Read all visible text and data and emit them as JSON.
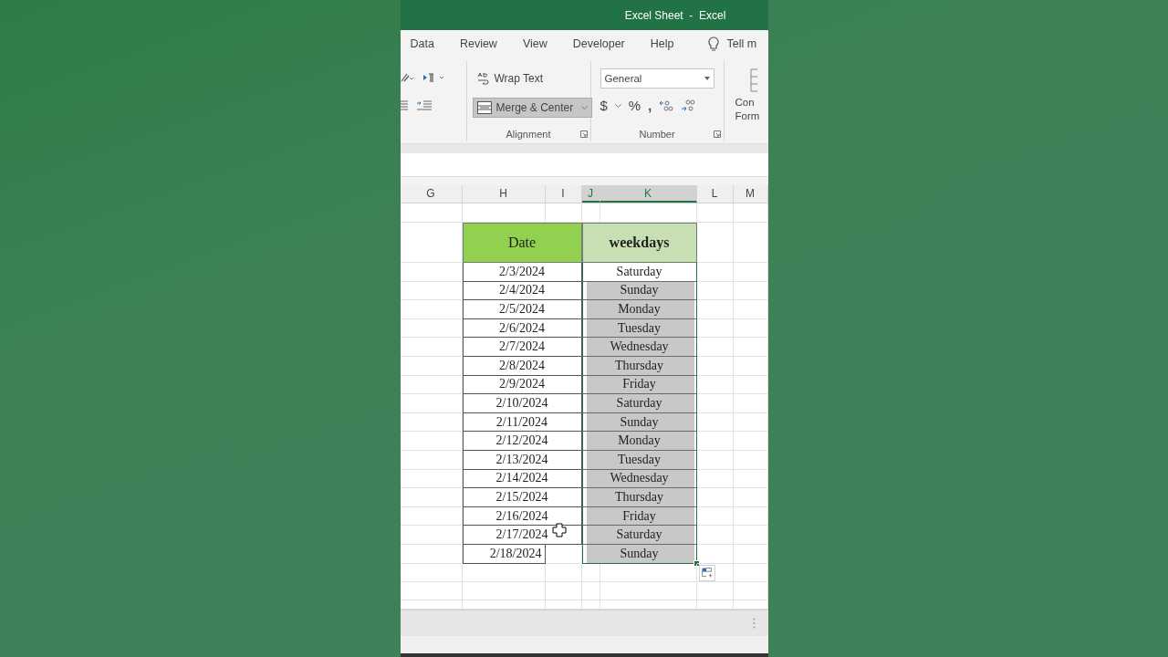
{
  "window": {
    "title": "Excel Sheet  -  Excel"
  },
  "ribbon_tabs": [
    "Data",
    "Review",
    "View",
    "Developer",
    "Help"
  ],
  "tell_me": "Tell m",
  "ribbon": {
    "alignment": {
      "label": "Alignment",
      "wrap_text": "Wrap Text",
      "merge_center": {
        "label": "Merge & Center",
        "pressed": true
      }
    },
    "number": {
      "label": "Number",
      "format": "General",
      "currency": "$",
      "percent": "%",
      "comma": ","
    },
    "cut_group": [
      "Con",
      "Form"
    ]
  },
  "sheet": {
    "columns": [
      {
        "label": "G",
        "selected": false
      },
      {
        "label": "H",
        "selected": false
      },
      {
        "label": "I",
        "selected": false
      },
      {
        "label": "J",
        "selected": true
      },
      {
        "label": "K",
        "selected": true
      },
      {
        "label": "L",
        "selected": false
      },
      {
        "label": "M",
        "selected": false
      }
    ],
    "header": {
      "date": "Date",
      "weekdays": "weekdays"
    },
    "rows": [
      {
        "date": "2/3/2024",
        "weekday": "Saturday",
        "highlighted": false,
        "merged": true
      },
      {
        "date": "2/4/2024",
        "weekday": "Sunday",
        "highlighted": true,
        "merged": true
      },
      {
        "date": "2/5/2024",
        "weekday": "Monday",
        "highlighted": true,
        "merged": true
      },
      {
        "date": "2/6/2024",
        "weekday": "Tuesday",
        "highlighted": true,
        "merged": true
      },
      {
        "date": "2/7/2024",
        "weekday": "Wednesday",
        "highlighted": true,
        "merged": true
      },
      {
        "date": "2/8/2024",
        "weekday": "Thursday",
        "highlighted": true,
        "merged": true
      },
      {
        "date": "2/9/2024",
        "weekday": "Friday",
        "highlighted": true,
        "merged": true
      },
      {
        "date": "2/10/2024",
        "weekday": "Saturday",
        "highlighted": true,
        "merged": true
      },
      {
        "date": "2/11/2024",
        "weekday": "Sunday",
        "highlighted": true,
        "merged": true
      },
      {
        "date": "2/12/2024",
        "weekday": "Monday",
        "highlighted": true,
        "merged": true
      },
      {
        "date": "2/13/2024",
        "weekday": "Tuesday",
        "highlighted": true,
        "merged": true
      },
      {
        "date": "2/14/2024",
        "weekday": "Wednesday",
        "highlighted": true,
        "merged": true
      },
      {
        "date": "2/15/2024",
        "weekday": "Thursday",
        "highlighted": true,
        "merged": true
      },
      {
        "date": "2/16/2024",
        "weekday": "Friday",
        "highlighted": true,
        "merged": true
      },
      {
        "date": "2/17/2024",
        "weekday": "Saturday",
        "highlighted": true,
        "merged": true
      },
      {
        "date": "2/18/2024",
        "weekday": "Sunday",
        "highlighted": true,
        "merged": false
      }
    ]
  }
}
